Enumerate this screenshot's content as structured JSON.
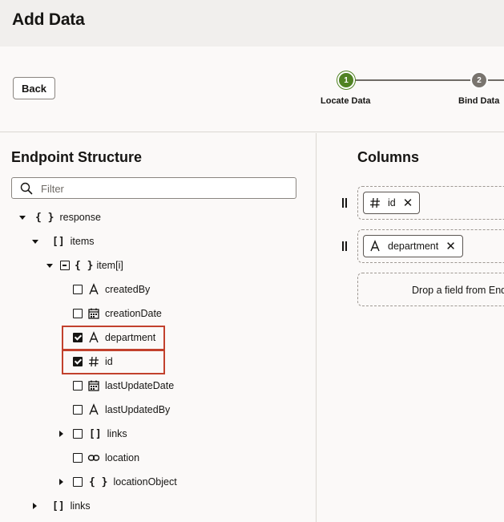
{
  "header": {
    "title": "Add Data"
  },
  "toolbar": {
    "back_label": "Back"
  },
  "train": {
    "steps": [
      {
        "number": "1",
        "label": "Locate Data",
        "state": "active"
      },
      {
        "number": "2",
        "label": "Bind Data",
        "state": "next"
      }
    ]
  },
  "endpoint": {
    "title": "Endpoint Structure",
    "filter_placeholder": "Filter",
    "tree": [
      {
        "label": "response",
        "kind": "object",
        "icon": "braces-icon",
        "expanded": true
      },
      {
        "label": "items",
        "kind": "array",
        "icon": "brackets-icon",
        "expanded": true
      },
      {
        "label": "item[i]",
        "kind": "object",
        "icon": "braces-icon",
        "expanded": true
      },
      {
        "label": "createdBy",
        "kind": "string",
        "icon": "text-type-icon",
        "checked": false
      },
      {
        "label": "creationDate",
        "kind": "date",
        "icon": "calendar-icon",
        "checked": false
      },
      {
        "label": "department",
        "kind": "string",
        "icon": "text-type-icon",
        "checked": true
      },
      {
        "label": "id",
        "kind": "number",
        "icon": "hash-icon",
        "checked": true
      },
      {
        "label": "lastUpdateDate",
        "kind": "date",
        "icon": "calendar-icon",
        "checked": false
      },
      {
        "label": "lastUpdatedBy",
        "kind": "string",
        "icon": "text-type-icon",
        "checked": false
      },
      {
        "label": "links",
        "kind": "array",
        "icon": "brackets-icon",
        "checked": false,
        "expanded": false
      },
      {
        "label": "location",
        "kind": "link",
        "icon": "link-icon",
        "checked": false
      },
      {
        "label": "locationObject",
        "kind": "object",
        "icon": "braces-icon",
        "checked": false,
        "expanded": false
      },
      {
        "label": "links",
        "kind": "array",
        "icon": "brackets-icon",
        "expanded": false
      }
    ]
  },
  "columns": {
    "title": "Columns",
    "items": [
      {
        "label": "id",
        "icon": "hash-icon"
      },
      {
        "label": "department",
        "icon": "text-type-icon"
      }
    ],
    "drop_hint": "Drop a field from End"
  },
  "colors": {
    "accent_green": "#508223",
    "highlight_red": "#c2412d",
    "step_grey": "#79746e"
  }
}
